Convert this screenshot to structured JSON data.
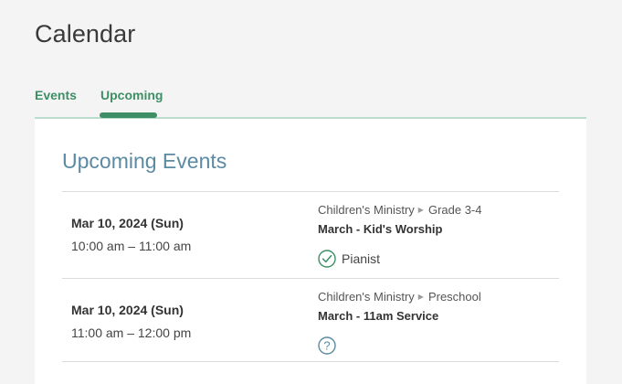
{
  "page": {
    "title": "Calendar"
  },
  "tabs": [
    {
      "label": "Events",
      "active": false
    },
    {
      "label": "Upcoming",
      "active": true
    }
  ],
  "section": {
    "title": "Upcoming Events"
  },
  "events": [
    {
      "date": "Mar 10, 2024 (Sun)",
      "time": "10:00 am – 11:00 am",
      "ministry": "Children's Ministry",
      "group": "Grade 3-4",
      "name": "March - Kid's Worship",
      "role": "Pianist",
      "status_icon": "check-circle-icon"
    },
    {
      "date": "Mar 10, 2024 (Sun)",
      "time": "11:00 am – 12:00 pm",
      "ministry": "Children's Ministry",
      "group": "Preschool",
      "name": "March - 11am Service",
      "role": "",
      "status_icon": "question-circle-icon"
    }
  ],
  "colors": {
    "accent": "#3e8f66",
    "tab_underline": "#b9dccd",
    "section_title": "#5b8aa3",
    "background": "#f4f4f4"
  }
}
